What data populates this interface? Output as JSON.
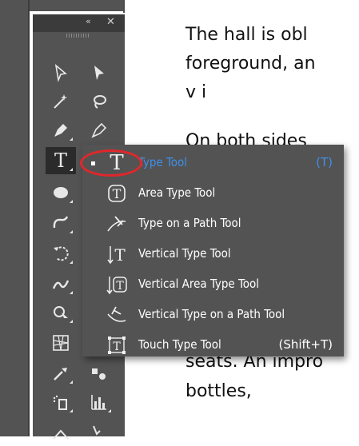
{
  "document": {
    "lines": [
      "The hall is obl",
      "foreground, an",
      "v                  i",
      "On both sides",
      "seats. An impro",
      "bottles,"
    ]
  },
  "tools_panel": {
    "collapse_glyph": "«",
    "close_glyph": "✕",
    "tools": [
      {
        "name": "selection-tool",
        "icon": "selection-arrow-outline-icon"
      },
      {
        "name": "direct-selection-tool",
        "icon": "direct-selection-arrow-icon"
      },
      {
        "name": "magic-wand-tool",
        "icon": "magic-wand-icon"
      },
      {
        "name": "lasso-tool",
        "icon": "lasso-icon"
      },
      {
        "name": "pen-tool",
        "icon": "pen-icon"
      },
      {
        "name": "curvature-tool",
        "icon": "curvature-pen-icon"
      },
      {
        "name": "type-tool",
        "icon": "type-t-icon",
        "glyph": "T",
        "active": true
      },
      {
        "name": "ellipse-tool",
        "icon": "ellipse-icon"
      },
      {
        "name": "shaper-tool",
        "icon": "shaper-icon"
      },
      {
        "name": "rotate-tool",
        "icon": "rotate-icon"
      },
      {
        "name": "warp-tool",
        "icon": "warp-icon"
      },
      {
        "name": "shape-builder-tool",
        "icon": "shape-builder-icon"
      },
      {
        "name": "perspective-grid-tool",
        "icon": "perspective-grid-icon"
      },
      {
        "name": "eyedropper-tool",
        "icon": "eyedropper-icon"
      },
      {
        "name": "blend-tool",
        "icon": "blend-icon"
      },
      {
        "name": "symbol-sprayer-tool",
        "icon": "symbol-sprayer-icon"
      },
      {
        "name": "column-graph-tool",
        "icon": "column-graph-icon"
      },
      {
        "name": "artboard-tool",
        "icon": "artboard-icon"
      },
      {
        "name": "slice-tool",
        "icon": "slice-icon"
      }
    ]
  },
  "flyout": {
    "items": [
      {
        "label": "Type Tool",
        "shortcut": "(T)",
        "icon": "type-icon",
        "glyph": "T",
        "selected": true
      },
      {
        "label": "Area Type Tool",
        "shortcut": "",
        "icon": "area-type-icon",
        "selected": false
      },
      {
        "label": "Type on a Path Tool",
        "shortcut": "",
        "icon": "type-on-path-icon",
        "selected": false
      },
      {
        "label": "Vertical Type Tool",
        "shortcut": "",
        "icon": "vertical-type-icon",
        "selected": false
      },
      {
        "label": "Vertical Area Type Tool",
        "shortcut": "",
        "icon": "vertical-area-type-icon",
        "selected": false
      },
      {
        "label": "Vertical Type on a Path Tool",
        "shortcut": "",
        "icon": "vertical-type-on-path-icon",
        "selected": false
      },
      {
        "label": "Touch Type Tool",
        "shortcut": "(Shift+T)",
        "icon": "touch-type-icon",
        "selected": false
      }
    ]
  },
  "colors": {
    "panel_bg": "#535353",
    "selected_text": "#3f8fe8",
    "highlight_ring": "#e0272b"
  }
}
